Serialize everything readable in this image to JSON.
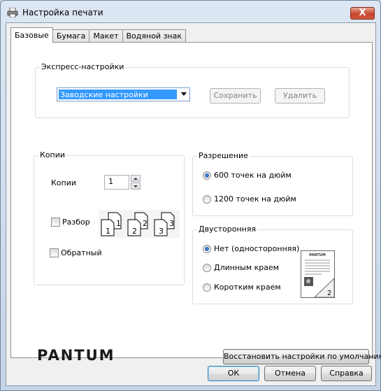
{
  "window": {
    "title": "Настройка печати",
    "close": "X"
  },
  "tabs": [
    {
      "label": "Базовые"
    },
    {
      "label": "Бумага"
    },
    {
      "label": "Макет"
    },
    {
      "label": "Водяной знак"
    }
  ],
  "express": {
    "group_label": "Экспресс-настройки",
    "selected": "Заводские настройки",
    "save_label": "Сохранить",
    "delete_label": "Удалить"
  },
  "copies": {
    "group_label": "Копии",
    "copies_label": "Копии",
    "copies_value": "1",
    "collate_label": "Разбор",
    "reverse_label": "Обратный",
    "collate_digits": [
      "1",
      "1",
      "2",
      "2",
      "3",
      "3"
    ]
  },
  "resolution": {
    "group_label": "Разрешение",
    "option_600": "600 точек на дюйм",
    "option_1200": "1200 точек на дюйм"
  },
  "duplex": {
    "group_label": "Двусторонняя",
    "option_none": "Нет (односторонняя)",
    "option_long": "Длинным краем",
    "option_short": "Коротким краем",
    "preview_logo": "PANTUM",
    "preview_page_number": "2"
  },
  "brand": {
    "logo_text": "PANTUM"
  },
  "restore_defaults_label": "Восстановить настройки по умолчанию",
  "dialog_buttons": {
    "ok": "ОК",
    "cancel": "Отмена",
    "help": "Справка"
  },
  "colors": {
    "selection": "#3399ff",
    "title_bar": "#dce7f3",
    "close_button": "#c7452d"
  }
}
